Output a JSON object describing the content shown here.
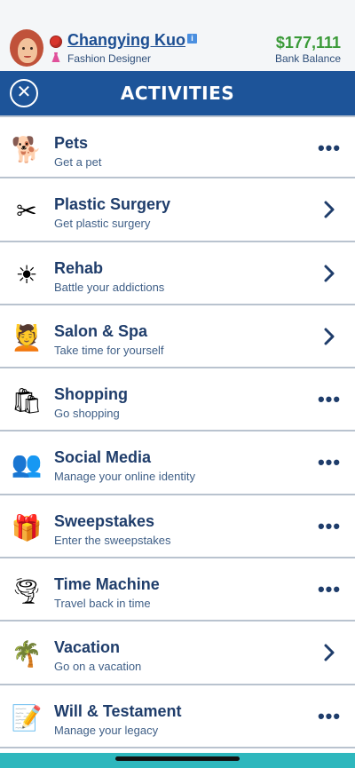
{
  "header": {
    "player_name": "Changying Kuo",
    "occupation": "Fashion Designer",
    "bank_amount": "$177,111",
    "bank_label": "Bank Balance",
    "info_icon": "info-icon",
    "colors": {
      "name": "#1c4e92",
      "money": "#3a9a38",
      "titlebar": "#1d5499"
    }
  },
  "titlebar": {
    "title": "ACTIVITIES",
    "close_icon": "close-icon"
  },
  "items": [
    {
      "label": "Pets",
      "sub": "Get a pet",
      "icon": "dog-icon",
      "glyph": "🐕",
      "action": "more"
    },
    {
      "label": "Plastic Surgery",
      "sub": "Get plastic surgery",
      "icon": "scissors-icon",
      "glyph": "✂",
      "action": "chevron"
    },
    {
      "label": "Rehab",
      "sub": "Battle your addictions",
      "icon": "sun-icon",
      "glyph": "☀",
      "action": "chevron"
    },
    {
      "label": "Salon & Spa",
      "sub": "Take time for yourself",
      "icon": "spa-person-icon",
      "glyph": "💆",
      "action": "chevron"
    },
    {
      "label": "Shopping",
      "sub": "Go shopping",
      "icon": "shopping-bags-icon",
      "glyph": "🛍",
      "action": "more"
    },
    {
      "label": "Social Media",
      "sub": "Manage your online identity",
      "icon": "people-silhouette-icon",
      "glyph": "👥",
      "action": "more"
    },
    {
      "label": "Sweepstakes",
      "sub": "Enter the sweepstakes",
      "icon": "gift-icon",
      "glyph": "🎁",
      "action": "more"
    },
    {
      "label": "Time Machine",
      "sub": "Travel back in time",
      "icon": "tornado-icon",
      "glyph": "🌪",
      "action": "more"
    },
    {
      "label": "Vacation",
      "sub": "Go on a vacation",
      "icon": "palm-tree-icon",
      "glyph": "🌴",
      "action": "chevron"
    },
    {
      "label": "Will & Testament",
      "sub": "Manage your legacy",
      "icon": "document-pen-icon",
      "glyph": "📝",
      "action": "more"
    }
  ]
}
